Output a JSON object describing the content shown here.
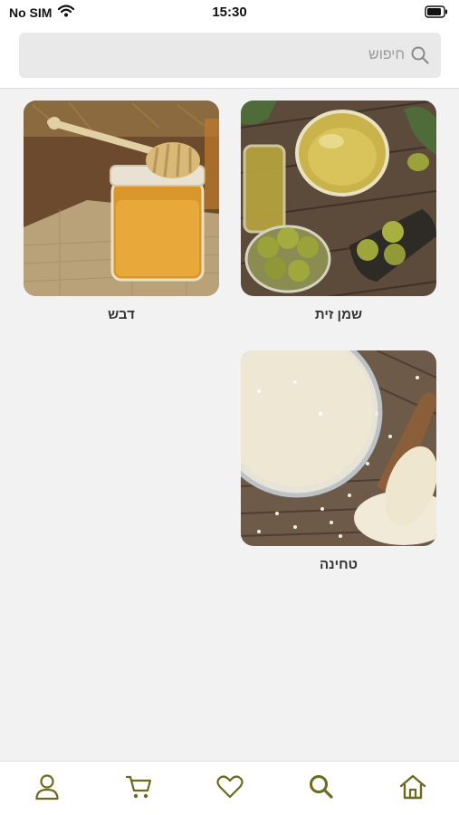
{
  "status_bar": {
    "carrier": "No SIM",
    "time": "15:30"
  },
  "search": {
    "placeholder": "חיפוש"
  },
  "categories": [
    {
      "label": "שמן זית",
      "image": "olive-oil-photo"
    },
    {
      "label": "דבש",
      "image": "honey-jar-photo"
    },
    {
      "label": "טחינה",
      "image": "tahini-bowl-photo"
    }
  ],
  "tab_bar": {
    "items": [
      {
        "icon": "home-icon"
      },
      {
        "icon": "search-icon"
      },
      {
        "icon": "heart-icon"
      },
      {
        "icon": "cart-icon"
      },
      {
        "icon": "profile-icon"
      }
    ]
  },
  "colors": {
    "accent": "#6b6a1e",
    "background": "#f2f2f2",
    "search_bg": "#e9e9ea"
  }
}
